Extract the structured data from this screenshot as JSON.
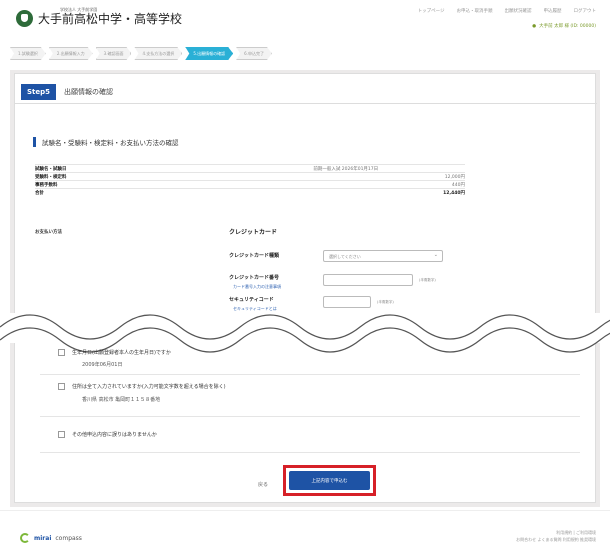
{
  "header": {
    "school_sub": "学校法人 大手前学園",
    "school_name": "大手前高松中学・高等学校",
    "nav": [
      "トップページ",
      "お申込・取消手順",
      "出願状況確認",
      "申込履歴",
      "ログアウト"
    ],
    "user": "大手前 太郎 様 (ID: 00000)"
  },
  "steps": [
    "1.試験選択",
    "2.出願情報入力",
    "3.確認画面",
    "4.支払方法の選択",
    "5.出願情報の確認",
    "6.申込完了"
  ],
  "step_badge": "Step5",
  "step_title": "出願情報の確認",
  "section_title": "試験名・受験料・検定料・お支払い方法の確認",
  "fees": [
    {
      "label": "試験名・試験日",
      "value": "前期一般入試 2026年01月17日"
    },
    {
      "label": "受験料・検定料",
      "value": "12,000円"
    },
    {
      "label": "事務手数料",
      "value": "440円"
    },
    {
      "label": "合計",
      "value": "12,440円"
    }
  ],
  "payment": {
    "label": "お支払い方法",
    "method": "クレジットカード",
    "card_type_label": "クレジットカード種類",
    "card_type_value": "選択してください",
    "card_number_label": "クレジットカード番号",
    "card_number_note": "(半角数字)",
    "card_number_link": "カード番号入力の注意事項",
    "security_label": "セキュリティコード",
    "security_note": "(半角数字)",
    "security_link": "セキュリティコードとは"
  },
  "checks": [
    {
      "text": "生年月日(出願登録者本人の生年月日)ですか",
      "sub": "2009年06月01日"
    },
    {
      "text": "住所は全て入力されていますか(入力可能文字数を超える場合を除く)",
      "sub": "香川県 高松市 亀岡町１１５８番地"
    },
    {
      "text": "その他申込内容に誤りはありませんか",
      "sub": ""
    }
  ],
  "back_label": "戻る",
  "submit_label": "上記内容で申込む",
  "footer": {
    "brand_bold": "mirai",
    "brand_rest": "compass",
    "links_1": "利用規約 | ご利用環境",
    "links_2": "お問合わせ よくある質問 利用規約 推奨環境"
  }
}
